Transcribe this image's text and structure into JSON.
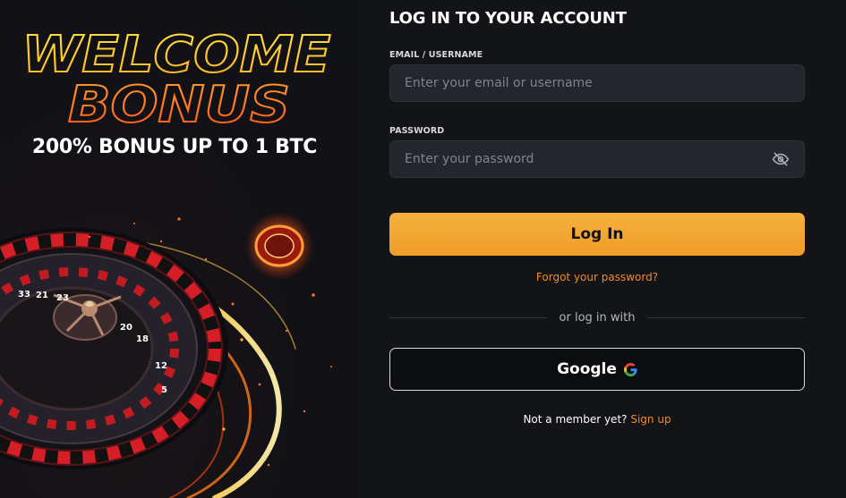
{
  "promo": {
    "headline_1": "WELCOME",
    "headline_2": "BONUS",
    "subheadline": "200% BONUS UP TO 1 BTC",
    "roulette_numbers": [
      "33",
      "21",
      "23",
      "20",
      "18",
      "12",
      "5"
    ]
  },
  "form": {
    "title": "LOG IN TO YOUR ACCOUNT",
    "email_label": "EMAIL / USERNAME",
    "email_placeholder": "Enter your email or username",
    "email_value": "",
    "password_label": "PASSWORD",
    "password_placeholder": "Enter your password",
    "password_value": "",
    "password_toggle_icon": "eye-slash-icon",
    "login_label": "Log In",
    "forgot_label": "Forgot your password?",
    "divider_label": "or log in with",
    "google_label": "Google",
    "google_icon": "google-g-icon",
    "signup_prompt": "Not a member yet?",
    "signup_link": "Sign up"
  },
  "colors": {
    "background": "#131418",
    "accent_orange": "#f08a2c",
    "button_gradient_top": "#f6b13e",
    "button_gradient_bottom": "#ef9c28",
    "input_bg": "#24262d"
  }
}
